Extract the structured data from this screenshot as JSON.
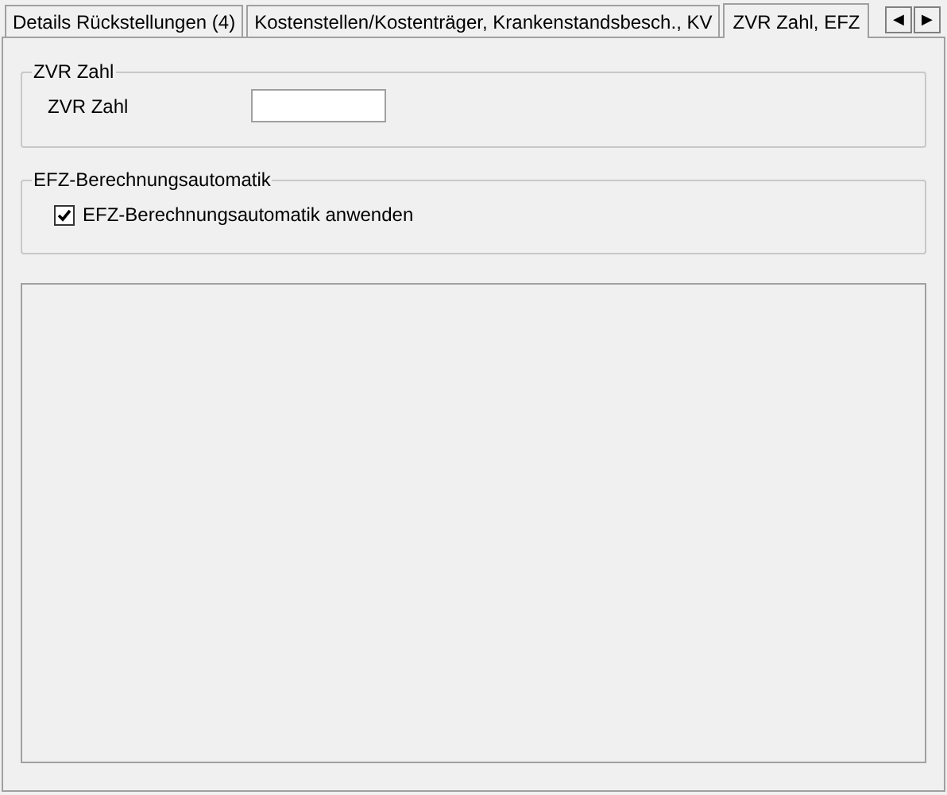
{
  "tabs": [
    {
      "label": "Details Rückstellungen (4)",
      "selected": false
    },
    {
      "label": "Kostenstellen/Kostenträger, Krankenstandsbesch., KV",
      "selected": false
    },
    {
      "label": "ZVR Zahl, EFZ",
      "selected": true
    }
  ],
  "tab_scroll": {
    "left": "◀",
    "right": "▶"
  },
  "zvr_group": {
    "title": "ZVR Zahl",
    "field_label": "ZVR Zahl"
  },
  "efz_group": {
    "title": "EFZ-Berechnungsautomatik",
    "checkbox": {
      "label": "EFZ-Berechnungsautomatik anwenden",
      "checked": true
    }
  }
}
